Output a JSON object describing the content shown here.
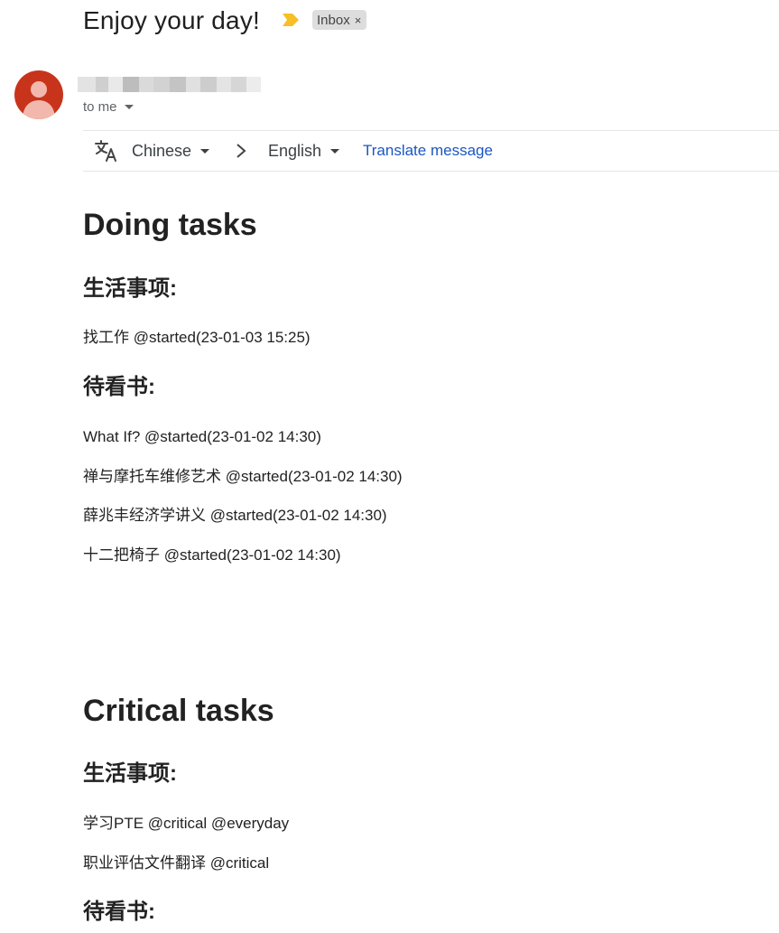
{
  "email": {
    "subject": "Enjoy your day!",
    "label": "Inbox",
    "label_remove": "×",
    "recipient": "to me"
  },
  "translate": {
    "from_lang": "Chinese",
    "to_lang": "English",
    "action": "Translate message"
  },
  "body": {
    "doing": {
      "title": "Doing tasks",
      "life_heading": "生活事项:",
      "life_items": [
        "找工作 @started(23-01-03 15:25)"
      ],
      "books_heading": "待看书:",
      "book_items": [
        "What If? @started(23-01-02 14:30)",
        "禅与摩托车维修艺术 @started(23-01-02 14:30)",
        "薛兆丰经济学讲义 @started(23-01-02 14:30)",
        "十二把椅子 @started(23-01-02 14:30)"
      ]
    },
    "critical": {
      "title": "Critical tasks",
      "life_heading": "生活事项:",
      "life_items": [
        "学习PTE @critical @everyday",
        "职业评估文件翻译 @critical"
      ],
      "books_heading": "待看书:"
    }
  },
  "colors": {
    "avatar": "#c8341b",
    "importance": "#f6bf26",
    "link": "#1a56c4"
  },
  "icons": {
    "importance": "importance-marker-icon",
    "translate": "translate-icon",
    "arrow": "chevron-right-icon"
  }
}
